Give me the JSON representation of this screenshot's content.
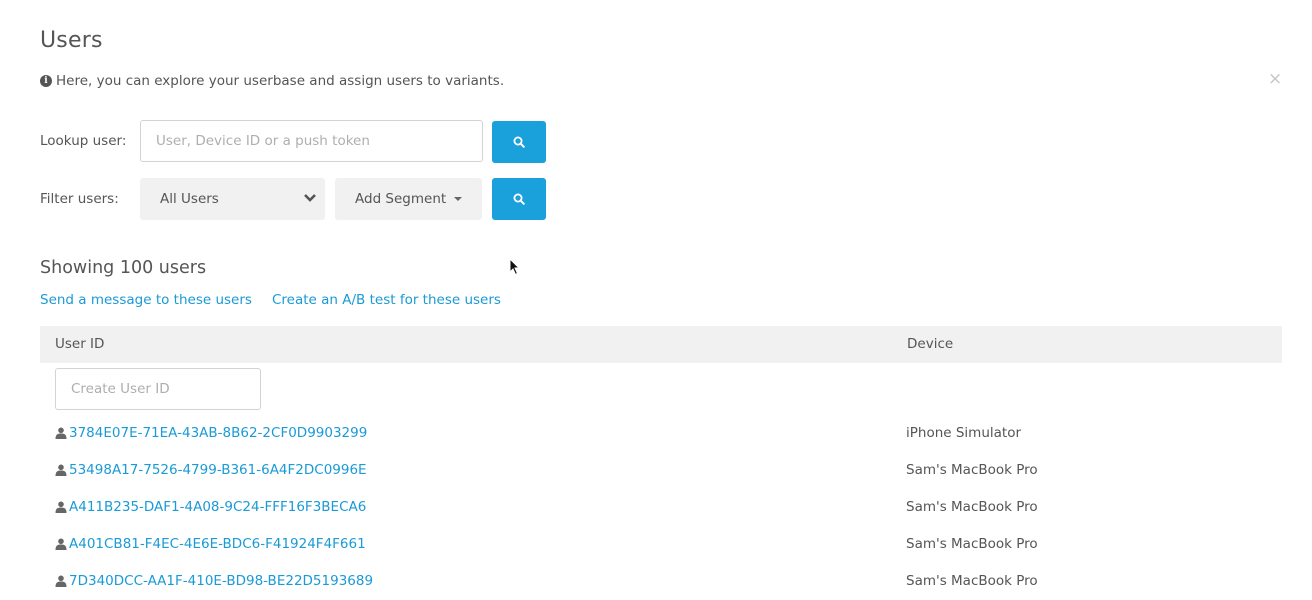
{
  "title": "Users",
  "info": "Here, you can explore your userbase and assign users to variants.",
  "close_label": "×",
  "lookup": {
    "label": "Lookup user:",
    "placeholder": "User, Device ID or a push token"
  },
  "filter": {
    "label": "Filter users:",
    "selected": "All Users",
    "segment_label": "Add Segment"
  },
  "showing": "Showing 100 users",
  "links": {
    "send_message": "Send a message to these users",
    "ab_test": "Create an A/B test for these users"
  },
  "table": {
    "headers": {
      "user_id": "User ID",
      "device": "Device"
    },
    "create_placeholder": "Create User ID",
    "rows": [
      {
        "id": "3784E07E-71EA-43AB-8B62-2CF0D9903299",
        "device": "iPhone Simulator"
      },
      {
        "id": "53498A17-7526-4799-B361-6A4F2DC0996E",
        "device": "Sam's MacBook Pro"
      },
      {
        "id": "A411B235-DAF1-4A08-9C24-FFF16F3BECA6",
        "device": "Sam's MacBook Pro"
      },
      {
        "id": "A401CB81-F4EC-4E6E-BDC6-F41924F4F661",
        "device": "Sam's MacBook Pro"
      },
      {
        "id": "7D340DCC-AA1F-410E-BD98-BE22D5193689",
        "device": "Sam's MacBook Pro"
      }
    ]
  },
  "colors": {
    "accent": "#1aa0db",
    "link": "#1a9ad6",
    "header_bg": "#f1f1f1",
    "text": "#555555"
  },
  "icons": {
    "info": "info-circle-icon",
    "close": "close-icon",
    "search": "search-icon",
    "chevron": "chevron-down-icon",
    "caret": "caret-down-icon",
    "user": "user-icon",
    "cursor": "mouse-cursor-icon"
  }
}
